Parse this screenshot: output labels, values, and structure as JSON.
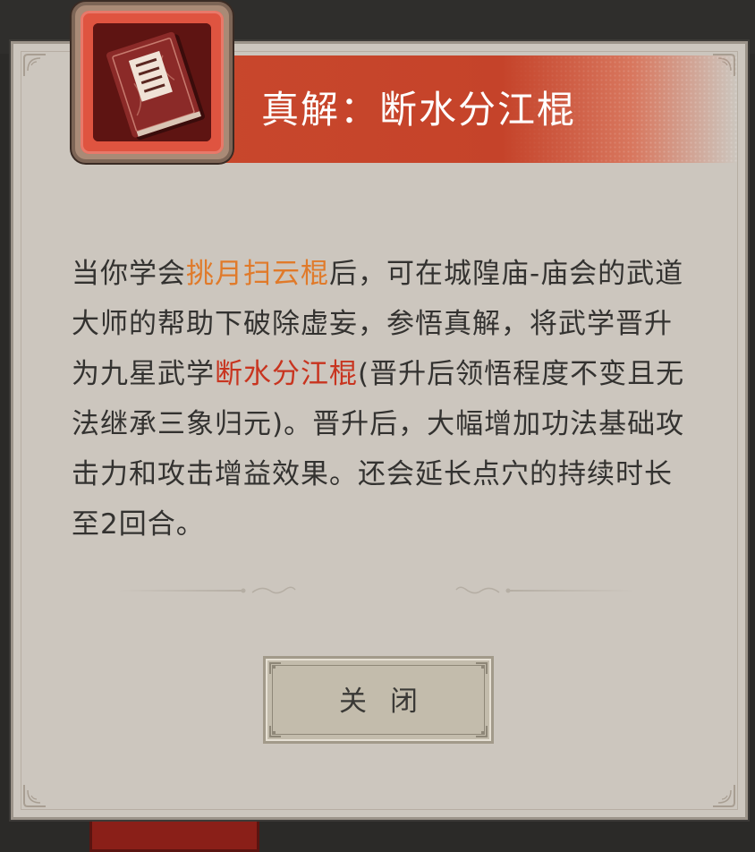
{
  "dialog": {
    "title": "真解：断水分江棍",
    "icon": "skill-book-icon",
    "description": {
      "part1": "当你学会",
      "skill_prereq": "挑月扫云棍",
      "part2": "后，可在城隍庙-庙会的武道大师的帮助下破除虚妄，参悟真解，将武学晋升为九星武学",
      "skill_result": "断水分江棍",
      "part3": "(晋升后领悟程度不变且无法继承三象归元)。晋升后，大幅增加功法基础攻击力和攻击增益效果。还会延长点穴的持续时长至2回合。"
    },
    "close_label": "关闭"
  },
  "colors": {
    "title_banner": "#c5432a",
    "highlight_prereq": "#e07a2a",
    "highlight_result": "#c8341f",
    "panel_background": "#ccc6be"
  }
}
